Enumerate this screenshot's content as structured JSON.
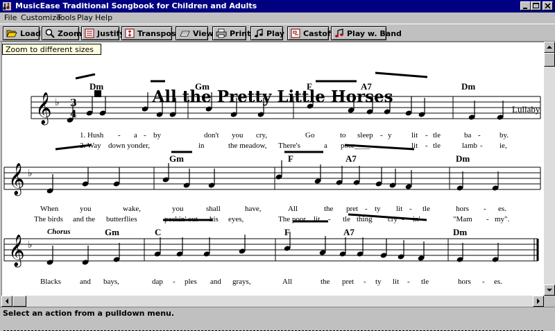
{
  "window": {
    "title": "MusicEase Traditional Songbook for Children and Adults"
  },
  "menu": [
    "File",
    "Customize",
    "Tools",
    "Play",
    "Help"
  ],
  "toolbar": {
    "load": "Load",
    "zoom": "Zoom",
    "justify": "Justify",
    "transpose": "Transpose",
    "view": "View",
    "print": "Print",
    "play": "Play",
    "castoff": "Castoff",
    "play_band": "Play w. Band"
  },
  "tooltip": "Zoom to different sizes",
  "song": {
    "title": "All the Pretty Little Horses",
    "subtitle": "Lullaby"
  },
  "chorus_label": "Chorus",
  "line1": {
    "chords": [
      "Dm",
      "Gm",
      "F",
      "A7",
      "Dm"
    ],
    "verse1": [
      "1. Hush",
      "-",
      "a",
      "-",
      "by",
      "don't",
      "you",
      "cry,",
      "Go",
      "to",
      "sleep",
      "-",
      "y",
      "lit",
      "-",
      "tle",
      "ba",
      "-",
      "by."
    ],
    "verse2": [
      "2. Way",
      "down yonder,",
      "in",
      "the meadow,",
      "There's",
      "a",
      "poor____",
      "lit",
      "-",
      "tle",
      "lamb",
      "-",
      "ie,"
    ]
  },
  "line2": {
    "chords": [
      "Gm",
      "F",
      "A7",
      "Dm"
    ],
    "verse1": [
      "When",
      "you",
      "wake,",
      "you",
      "shall",
      "have,",
      "All",
      "the",
      "pret",
      "-",
      "ty",
      "lit",
      "-",
      "tle",
      "hors",
      "-",
      "es."
    ],
    "verse2": [
      "The birds",
      "and the",
      "butterflies",
      "peckin' out",
      "his",
      "eyes,",
      "The poor",
      "lit",
      "-",
      "tle",
      "thing",
      "cry",
      "-",
      "in'",
      "\"Mam",
      "-",
      "my\"."
    ]
  },
  "line3": {
    "chords": [
      "Gm",
      "C",
      "F",
      "A7",
      "Dm"
    ],
    "verse1": [
      "Blacks",
      "and",
      "bays,",
      "dap",
      "-",
      "ples",
      "and",
      "grays,",
      "All",
      "the",
      "pret",
      "-",
      "ty",
      "lit",
      "-",
      "tle",
      "hors",
      "-",
      "es."
    ]
  },
  "status": "Select an action from a pulldown menu."
}
